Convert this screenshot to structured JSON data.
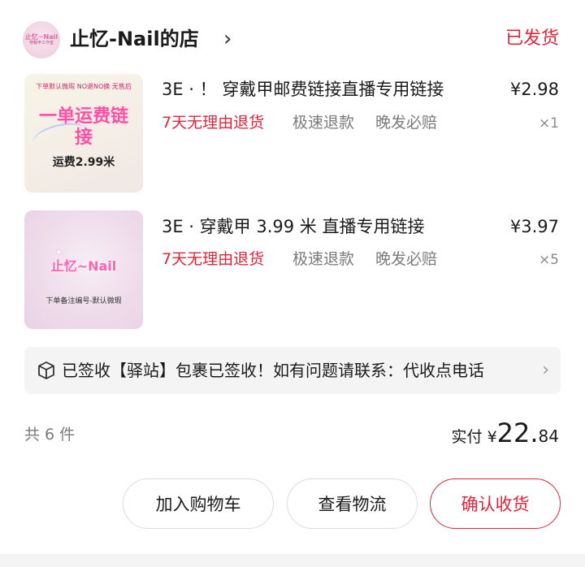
{
  "shop": {
    "logo_line1": "止忆~Nail",
    "logo_line2": "穿戴甲工作室",
    "name": "止忆-Nail的店",
    "chevron": "›",
    "status": "已发货"
  },
  "products": [
    {
      "thumb_top_text": "下单默认微瑕  NO退NO换  无售后",
      "thumb_main_text": "一单运费链接",
      "thumb_bottom_text": "运费2.99米",
      "title": "3E · ！ 穿戴甲邮费链接直播专用链接",
      "price": "¥2.98",
      "tags": [
        "7天无理由退货",
        "极速退款",
        "晚发必赔"
      ],
      "qty": "×1"
    },
    {
      "thumb_main_text": "止忆~Nail",
      "thumb_bottom_text": "下单备注编号-默认微瑕",
      "title": "3E · 穿戴甲 3.99 米 直播专用链接",
      "price": "¥3.97",
      "tags": [
        "7天无理由退货",
        "极速退款",
        "晚发必赔"
      ],
      "qty": "×5"
    }
  ],
  "logistics": {
    "icon": "package-icon",
    "text": "已签收【驿站】包裹已签收！如有问题请联系：代收点电话",
    "chevron": "›"
  },
  "summary": {
    "count_text": "共 6 件",
    "paid_label": "实付",
    "currency": "¥",
    "amount_int": "22.",
    "amount_dec": "84"
  },
  "actions": {
    "add_to_cart": "加入购物车",
    "view_logistics": "查看物流",
    "confirm_receipt": "确认收货"
  },
  "colors": {
    "accent": "#e2233a",
    "muted": "#7a7a7a",
    "panel": "#f4f4f4"
  }
}
